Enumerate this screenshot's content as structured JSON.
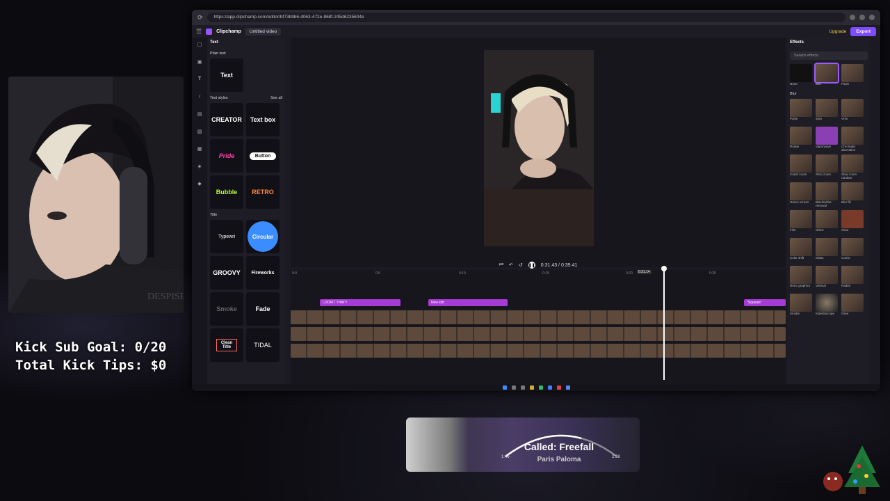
{
  "browser": {
    "url": "https://app.clipchamp.com/editor/bf73b9b6-d063-472e-868f-245d6235604e"
  },
  "app": {
    "name": "Clipchamp",
    "project": "Untitled video",
    "upgrade": "Upgrade",
    "export": "Export"
  },
  "rail": [
    "Your media",
    "Record & create",
    "Text",
    "Music",
    "Stock video",
    "Stock images",
    "Templates",
    "Graphics",
    "Brand kit"
  ],
  "text_panel": {
    "title": "Text",
    "plain_text_label": "Plain text",
    "plain_text_tile": "Text",
    "text_styles_label": "Text styles",
    "see_all": "See all",
    "styles": [
      "CREATOR",
      "Text box",
      "Pride",
      "Button",
      "Bubble",
      "RETRO"
    ],
    "title_label": "Title",
    "titles": [
      "Typewri",
      "Circular",
      "GROOVY",
      "Fireworks",
      "Smoke",
      "Fade",
      "Clean Title",
      "TIDAL"
    ]
  },
  "transport": {
    "time": "0:31.43 / 0:39.41"
  },
  "timeline": {
    "ruler": [
      "0:0",
      "0:5",
      "0:10",
      "0:15",
      "0:20",
      "0:25",
      "0:30",
      "0:35"
    ],
    "playhead_label": "0:31.14",
    "title_clips": [
      "LOOKIT THAT!!",
      "New kith",
      "\"Squeals\""
    ]
  },
  "effects": {
    "title": "Effects",
    "search_placeholder": "Search effects",
    "selected_section": "Blur",
    "items": [
      "None",
      "Blur",
      "Flash",
      "Pulse",
      "Spin",
      "VHS",
      "Rotate",
      "Vaporwave",
      "Chromatic aberration",
      "Crash zoom",
      "Slow zoom",
      "Slow zoom random",
      "Green screen",
      "Black/white removal",
      "Blur fill",
      "Film",
      "Glitch",
      "Glow",
      "Color shift",
      "Glass",
      "Comic",
      "Retro graphics",
      "Vertical",
      "Radial",
      "Smoke",
      "Kaleidoscope",
      "Glow"
    ]
  },
  "overlay": {
    "sub_goal": "Kick Sub Goal: 0/20",
    "tips": "Total Kick Tips: $0"
  },
  "now_playing": {
    "song": "Called: Freefall",
    "artist": "Paris Paloma",
    "elapsed": "1:46",
    "duration": "2:38",
    "progress": 0.67
  },
  "colors": {
    "accent": "#7d4cff",
    "title_clip": "#a63bd6",
    "upgrade": "#f2c94c"
  }
}
